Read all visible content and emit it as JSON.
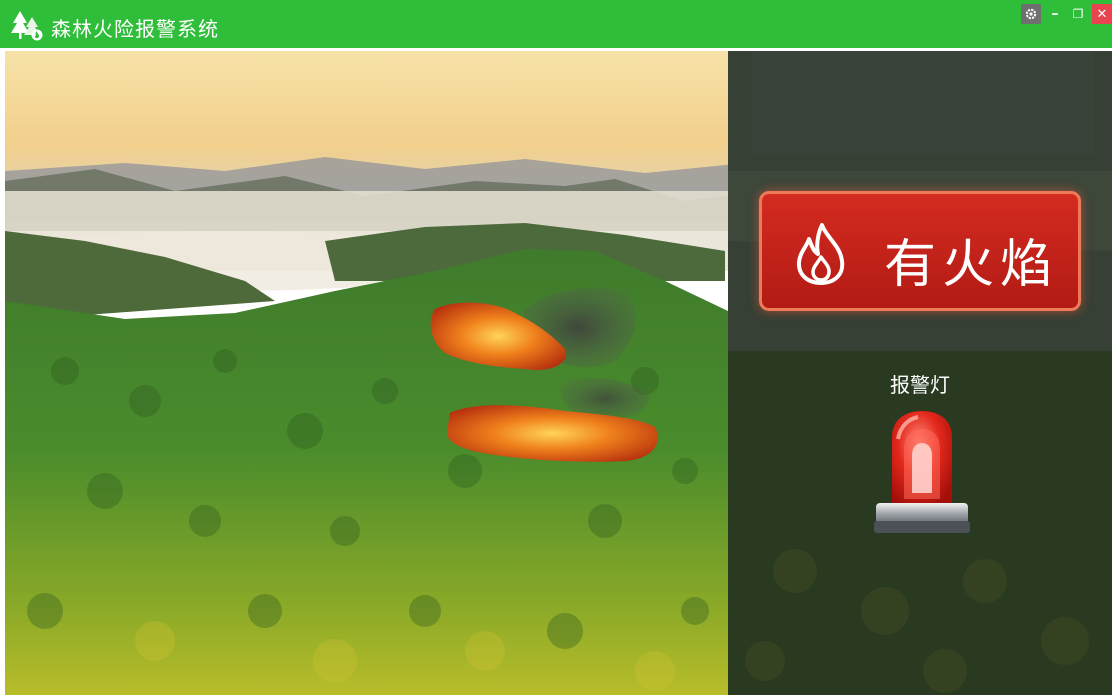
{
  "window": {
    "title": "森林火险报警系统",
    "controls": {
      "settings_icon": "gear-icon",
      "minimize_glyph": "–",
      "restore_glyph": "❐",
      "close_glyph": "✕"
    }
  },
  "scene": {
    "description_icons": [
      "fire-overlay",
      "smoke-overlay"
    ]
  },
  "status": {
    "fire_label": "有火焰",
    "fire_icon": "flame-icon"
  },
  "alarm": {
    "label": "报警灯",
    "icon": "alarm-lamp-icon",
    "state": "on"
  },
  "colors": {
    "titlebar": "#2fbe3a",
    "close": "#e8434f",
    "alert_red": "#c8241a",
    "alert_border": "#ef7a5a"
  }
}
